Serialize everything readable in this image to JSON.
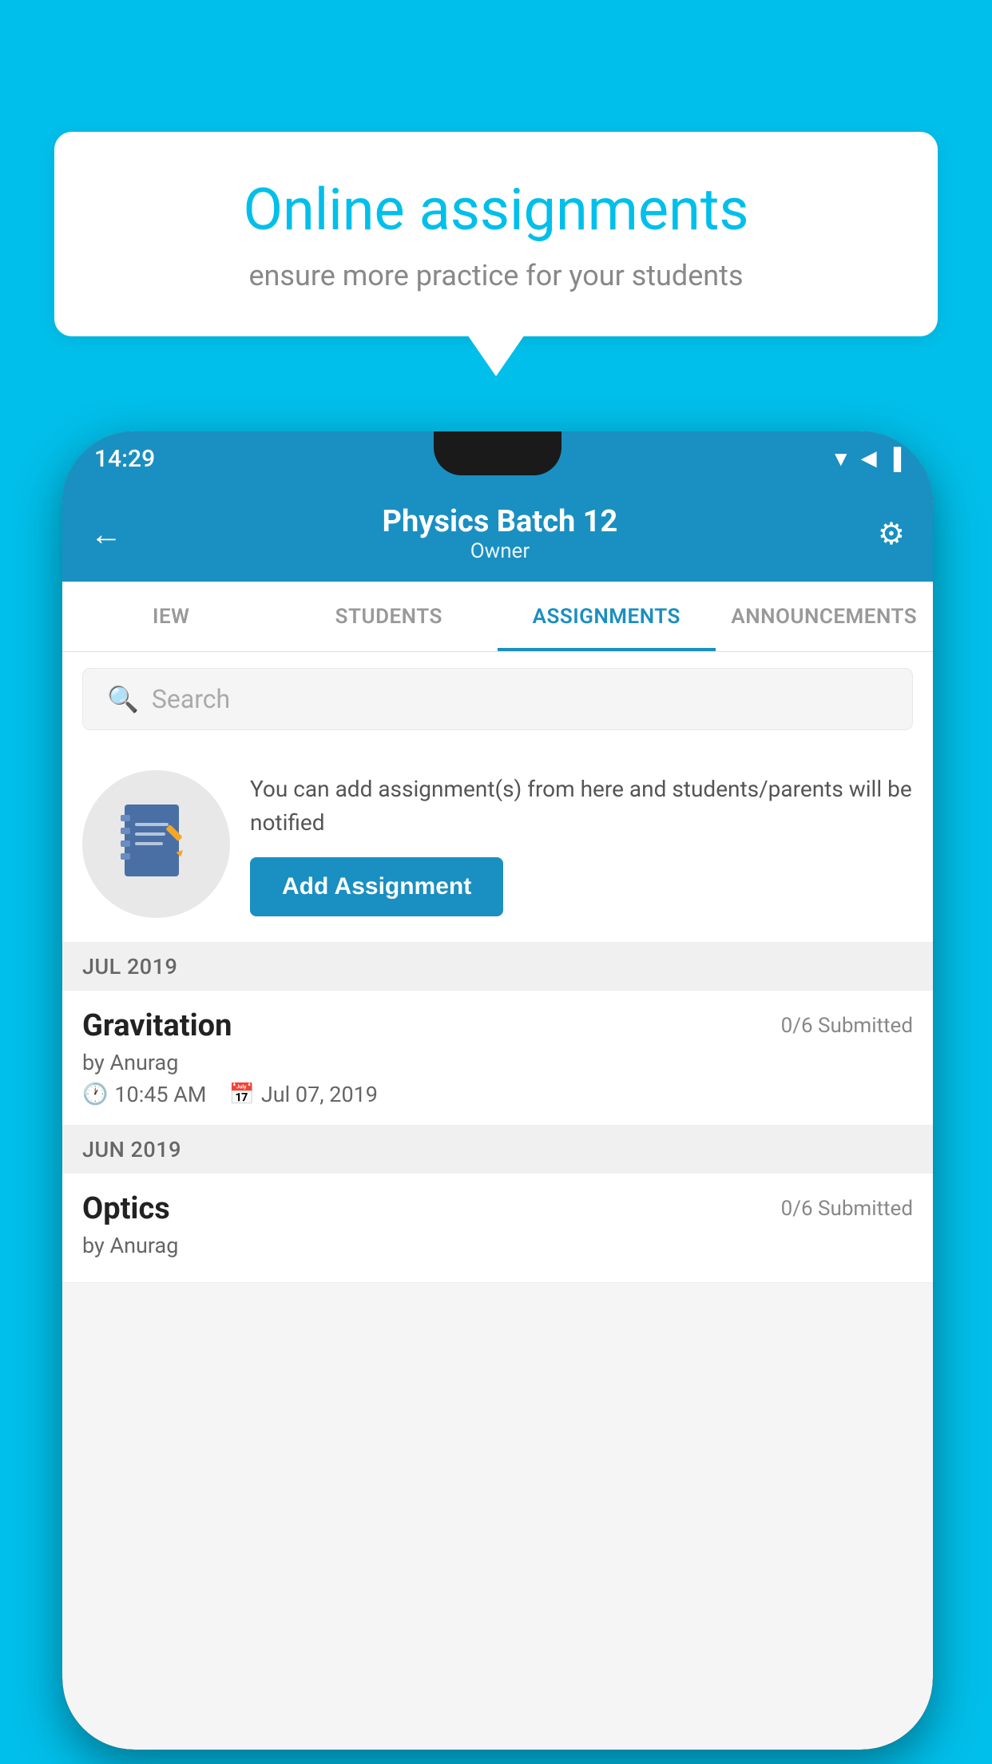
{
  "background_color": "#00BFEA",
  "speech_bubble": {
    "title": "Online assignments",
    "subtitle": "ensure more practice for your students"
  },
  "status_bar": {
    "time": "14:29",
    "signal_icons": "▲ ◀ ▐"
  },
  "header": {
    "title": "Physics Batch 12",
    "subtitle": "Owner",
    "back_icon": "←",
    "settings_icon": "⚙"
  },
  "tabs": [
    {
      "label": "IEW",
      "active": false
    },
    {
      "label": "STUDENTS",
      "active": false
    },
    {
      "label": "ASSIGNMENTS",
      "active": true
    },
    {
      "label": "ANNOUNCEMENTS",
      "active": false
    }
  ],
  "search": {
    "placeholder": "Search"
  },
  "promo": {
    "description": "You can add assignment(s) from here and students/parents will be notified",
    "button_label": "Add Assignment"
  },
  "sections": [
    {
      "label": "JUL 2019",
      "assignments": [
        {
          "name": "Gravitation",
          "status": "0/6 Submitted",
          "by": "by Anurag",
          "time": "10:45 AM",
          "date": "Jul 07, 2019"
        }
      ]
    },
    {
      "label": "JUN 2019",
      "assignments": [
        {
          "name": "Optics",
          "status": "0/6 Submitted",
          "by": "by Anurag",
          "time": "",
          "date": ""
        }
      ]
    }
  ]
}
